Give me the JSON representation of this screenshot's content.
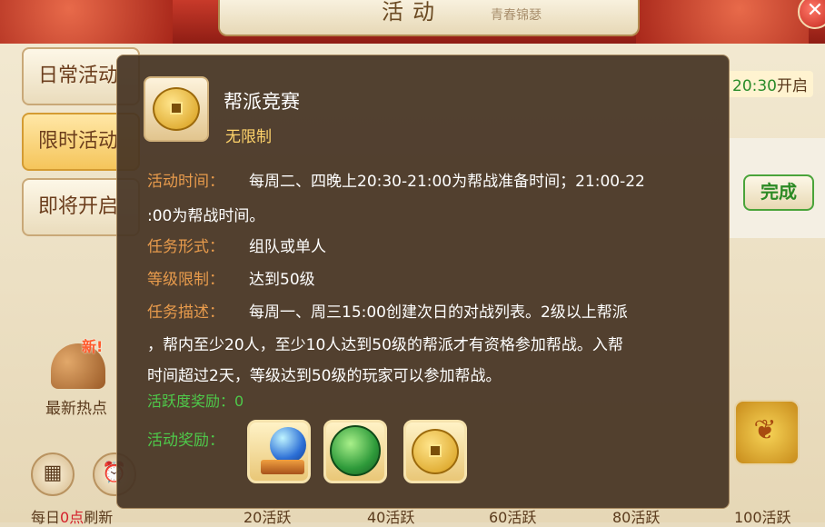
{
  "header": {
    "title": "活动",
    "calligraphy": "青春锦瑟"
  },
  "sidebar": {
    "items": [
      {
        "label": "日常活动"
      },
      {
        "label": "限时活动"
      },
      {
        "label": "即将开启"
      }
    ]
  },
  "hot_news": {
    "badge": "新!",
    "label": "最新热点"
  },
  "footer": {
    "daily_refresh_prefix": "每日",
    "daily_refresh_num": "0点",
    "daily_refresh_suffix": "刷新",
    "milestones": [
      "20活跃",
      "40活跃",
      "60活跃",
      "80活跃",
      "100活跃"
    ]
  },
  "right_panel": {
    "time": "20:30",
    "open": "开启",
    "complete": "完成"
  },
  "popup": {
    "title": "帮派竞赛",
    "subtitle": "无限制",
    "rows": {
      "time_label": "活动时间：",
      "time_line1": "每周二、四晚上20:30-21:00为帮战准备时间；21:00-22",
      "time_line2": ":00为帮战时间。",
      "form_label": "任务形式：",
      "form_value": "组队或单人",
      "level_label": "等级限制：",
      "level_value": "达到50级",
      "desc_label": "任务描述：",
      "desc_line1": "每周一、周三15:00创建次日的对战列表。2级以上帮派",
      "desc_line2": "，帮内至少20人，至少10人达到50级的帮派才有资格参加帮战。入帮",
      "desc_line3": "时间超过2天，等级达到50级的玩家可以参加帮战。"
    },
    "activity_reward": "活跃度奖励：0",
    "reward_label": "活动奖励："
  }
}
